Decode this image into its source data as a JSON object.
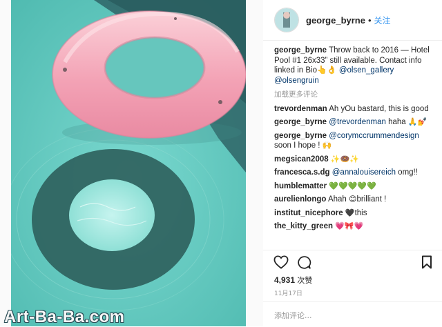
{
  "post": {
    "username": "george_byrne",
    "dot": "•",
    "follow_label": "关注",
    "caption_user": "george_byrne",
    "caption_text": "Throw back to 2016 — Hotel Pool #1 26x33” still available. Contact info linked in Bio👆👌",
    "caption_mentions": "@olsen_gallery @olsengruin",
    "load_more": "加载更多评论"
  },
  "comments": [
    {
      "user": "trevordenman",
      "text": "Ah yOu bastard, this is good",
      "emoji": ""
    },
    {
      "user": "george_byrne",
      "mention": "@trevordenman",
      "text": " haha ",
      "emoji": "🙏💅"
    },
    {
      "user": "george_byrne",
      "mention": "@corymccrummendesign",
      "text": " soon I hope ! ",
      "emoji": "🙌"
    },
    {
      "user": "megsican2008",
      "text": " ",
      "emoji": "✨🍩✨"
    },
    {
      "user": "francesca.s.dg",
      "mention": "@annalouisereich",
      "text": " omg!!",
      "emoji": ""
    },
    {
      "user": "humblematter",
      "text": " ",
      "emoji": "💚💚💚💚💚"
    },
    {
      "user": "aurelienlongo",
      "text": " Ahah ",
      "text2": "brilliant !",
      "emoji": "😊"
    },
    {
      "user": "institut_nicephore",
      "text": "this",
      "emoji": "🖤"
    },
    {
      "user": "the_kitty_green",
      "text": " ",
      "emoji": "💗🎀💗"
    }
  ],
  "likes": {
    "count": "4,931",
    "unit": "次赞"
  },
  "date": "11月17日",
  "add_comment_placeholder": "添加评论...",
  "watermark": "Art-Ba-Ba.com",
  "colors": {
    "pool_water": "#5cc6bb",
    "pool_deck": "#2e5e60",
    "float_pink": "#f3a3b4",
    "link_blue": "#003569",
    "follow_blue": "#3897f0"
  },
  "icons": [
    "heart-icon",
    "comment-icon",
    "bookmark-icon"
  ]
}
